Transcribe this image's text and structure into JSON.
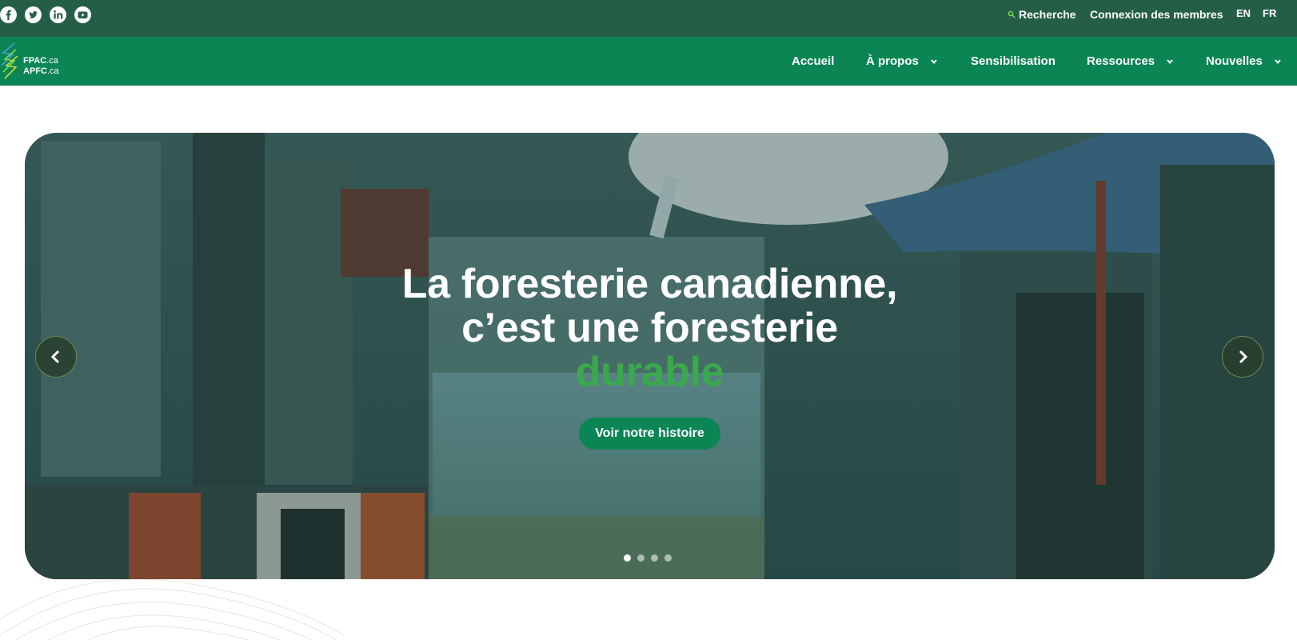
{
  "topbar": {
    "social": [
      {
        "name": "facebook-icon"
      },
      {
        "name": "twitter-icon"
      },
      {
        "name": "linkedin-icon"
      },
      {
        "name": "youtube-icon"
      }
    ],
    "search_label": "Recherche",
    "members_label": "Connexion des membres",
    "lang_en": "EN",
    "lang_fr": "FR"
  },
  "logo": {
    "line1_main": "FPAC",
    "line1_suffix": ".ca",
    "line2_main": "APFC",
    "line2_suffix": ".ca"
  },
  "nav": {
    "accueil": "Accueil",
    "apropos": "À propos",
    "sensibilisation": "Sensibilisation",
    "ressources": "Ressources",
    "nouvelles": "Nouvelles"
  },
  "hero": {
    "title_line1": "La foresterie canadienne,",
    "title_line2": "c’est une foresterie",
    "title_accent": "durable",
    "cta_label": "Voir notre histoire",
    "slides_total": 4,
    "active_slide": 1
  },
  "colors": {
    "topbar_bg": "#245e47",
    "nav_bg": "#0a8553",
    "accent_green": "#3aa94c",
    "button_bg": "#0a8553"
  }
}
